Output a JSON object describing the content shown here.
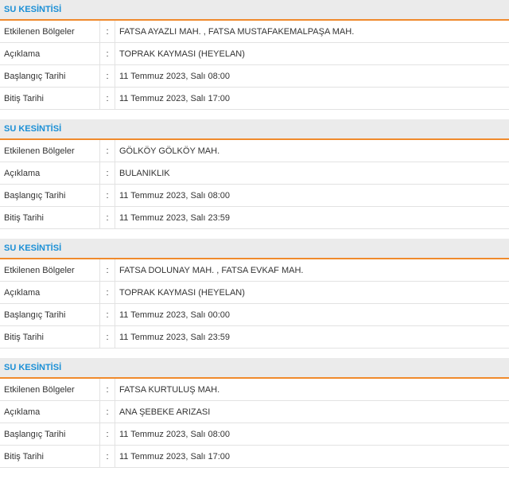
{
  "labels": {
    "affected_regions": "Etkilenen Bölgeler",
    "description": "Açıklama",
    "start_date": "Başlangıç Tarihi",
    "end_date": "Bitiş Tarihi",
    "separator": ":"
  },
  "colors": {
    "header_title": "#1a8fd6",
    "header_border": "#f08a2c",
    "header_background": "#ebebeb"
  },
  "outages": [
    {
      "title": "SU KESİNTİSİ",
      "affected_regions": "FATSA AYAZLI MAH. , FATSA MUSTAFAKEMALPAŞA MAH.",
      "description": "TOPRAK KAYMASI (HEYELAN)",
      "start_date": "11 Temmuz 2023, Salı 08:00",
      "end_date": "11 Temmuz 2023, Salı 17:00"
    },
    {
      "title": "SU KESİNTİSİ",
      "affected_regions": "GÖLKÖY GÖLKÖY MAH.",
      "description": "BULANIKLIK",
      "start_date": "11 Temmuz 2023, Salı 08:00",
      "end_date": "11 Temmuz 2023, Salı 23:59"
    },
    {
      "title": "SU KESİNTİSİ",
      "affected_regions": "FATSA DOLUNAY MAH. , FATSA EVKAF MAH.",
      "description": "TOPRAK KAYMASI (HEYELAN)",
      "start_date": "11 Temmuz 2023, Salı 00:00",
      "end_date": "11 Temmuz 2023, Salı 23:59"
    },
    {
      "title": "SU KESİNTİSİ",
      "affected_regions": "FATSA KURTULUŞ MAH.",
      "description": "ANA ŞEBEKE ARIZASI",
      "start_date": "11 Temmuz 2023, Salı 08:00",
      "end_date": "11 Temmuz 2023, Salı 17:00"
    }
  ]
}
